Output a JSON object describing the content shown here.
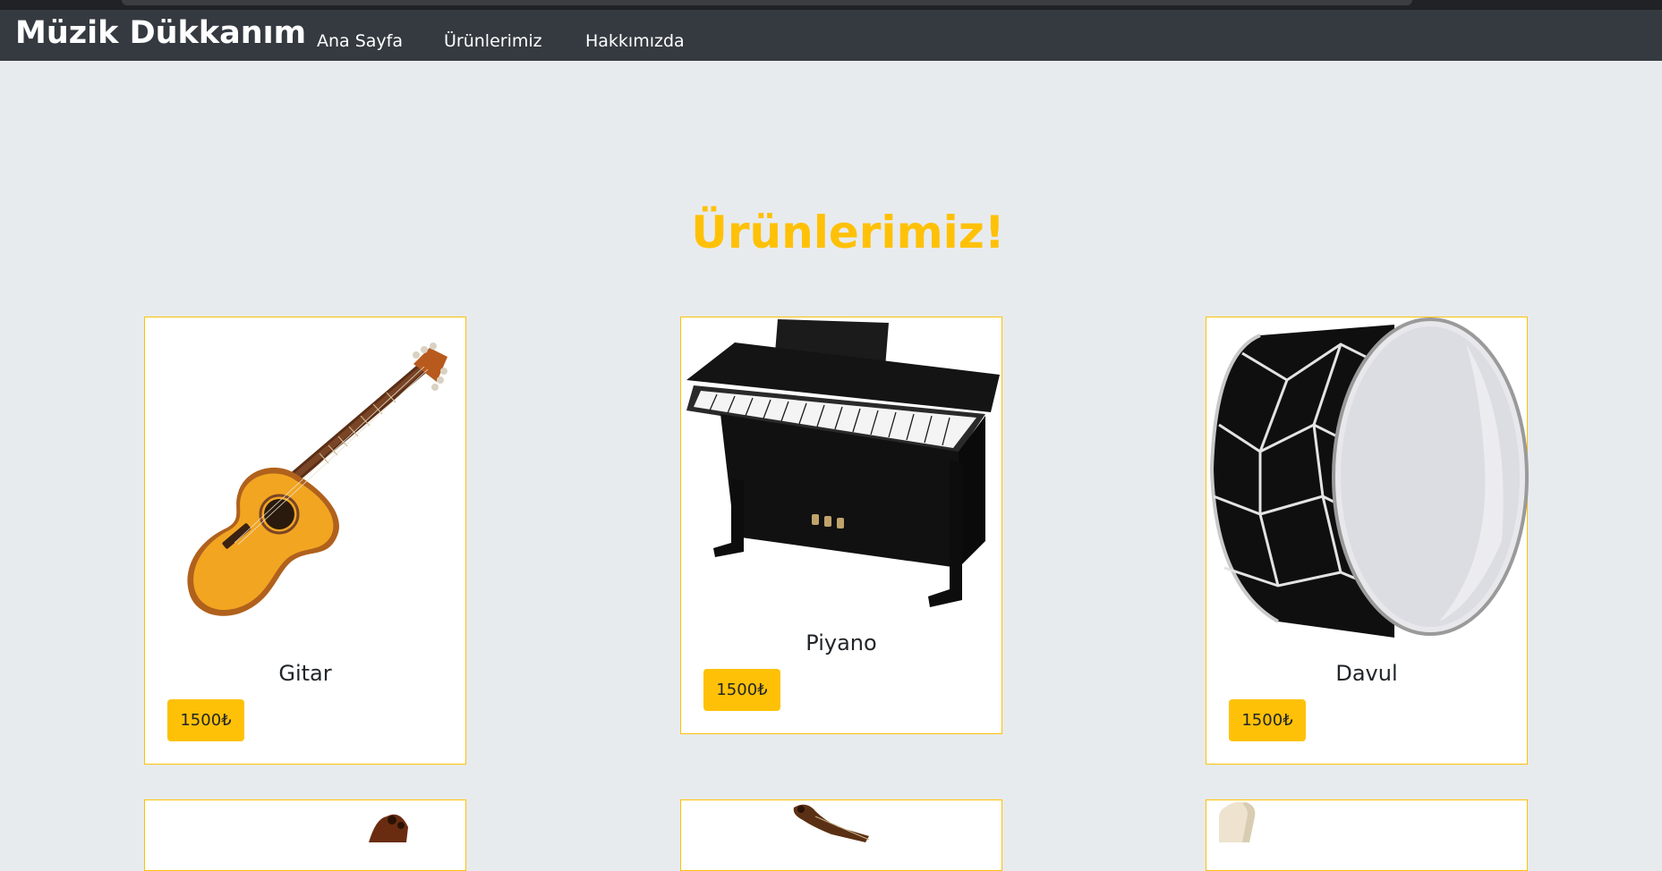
{
  "navbar": {
    "brand": "Müzik Dükkanım",
    "links": [
      "Ana Sayfa",
      "Ürünlerimiz",
      "Hakkımızda"
    ]
  },
  "main": {
    "heading": "Ürünlerimiz!",
    "products": [
      {
        "name": "Gitar",
        "price": "1500₺",
        "icon": "guitar-icon"
      },
      {
        "name": "Piyano",
        "price": "1500₺",
        "icon": "piano-icon"
      },
      {
        "name": "Davul",
        "price": "1500₺",
        "icon": "drum-icon"
      }
    ],
    "partial_products": [
      {
        "icon": "violin-icon"
      },
      {
        "icon": "violin-icon"
      },
      {
        "icon": "flute-icon"
      }
    ]
  },
  "colors": {
    "navbar": "#343a40",
    "accent": "#ffc107",
    "background": "#e8ebee"
  }
}
